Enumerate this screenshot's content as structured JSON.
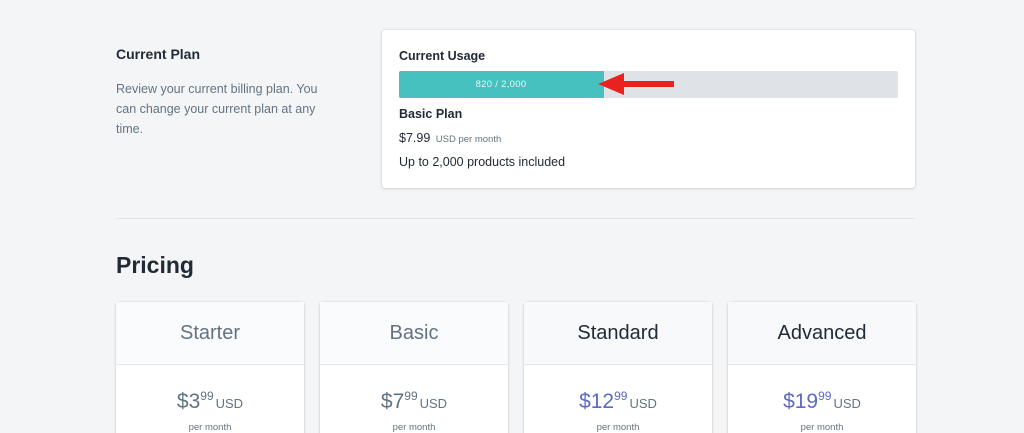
{
  "current_plan": {
    "heading": "Current Plan",
    "description": "Review your current billing plan. You can change your current plan at any time."
  },
  "usage_card": {
    "title": "Current Usage",
    "usage_text": "820 / 2,000",
    "usage_used": 820,
    "usage_limit": 2000,
    "usage_fraction_shown": 0.41,
    "plan_name": "Basic Plan",
    "price": "$7.99",
    "price_unit": "USD per month",
    "included": "Up to 2,000 products included",
    "bar_color": "#47c1bf",
    "arrow_color": "#e8231f"
  },
  "pricing": {
    "title": "Pricing",
    "tiers": [
      {
        "name": "Starter",
        "dollars": "$3",
        "cents": "99",
        "currency": "USD",
        "period": "per month"
      },
      {
        "name": "Basic",
        "dollars": "$7",
        "cents": "99",
        "currency": "USD",
        "period": "per month"
      },
      {
        "name": "Standard",
        "dollars": "$12",
        "cents": "99",
        "currency": "USD",
        "period": "per month"
      },
      {
        "name": "Advanced",
        "dollars": "$19",
        "cents": "99",
        "currency": "USD",
        "period": "per month"
      }
    ]
  }
}
